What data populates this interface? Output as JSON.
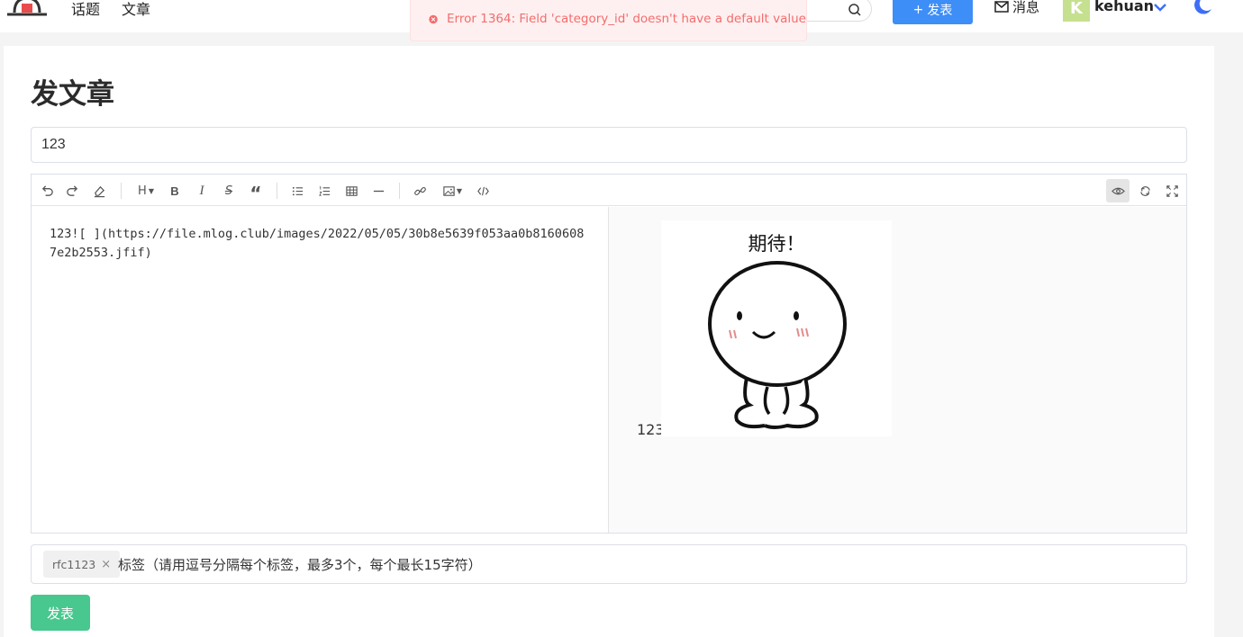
{
  "nav": {
    "links": [
      "话题",
      "文章"
    ],
    "publish_label": "发表",
    "messages_label": "消息",
    "avatar_letter": "K",
    "username": "kehuan"
  },
  "toast": {
    "type": "error",
    "message": "Error 1364: Field 'category_id' doesn't have a default value"
  },
  "page": {
    "title": "发文章",
    "title_input_value": "123"
  },
  "toolbar": {
    "items": [
      "undo",
      "redo",
      "clear-format",
      "heading",
      "bold",
      "italic",
      "strikethrough",
      "quote",
      "unordered-list",
      "ordered-list",
      "table",
      "horizontal-rule",
      "link",
      "image",
      "code-block",
      "preview",
      "sync-scroll",
      "fullscreen"
    ],
    "heading_label": "H",
    "bold_label": "B",
    "italic_label": "I",
    "strike_label": "S",
    "quote_label": "“"
  },
  "editor": {
    "content": "123![ ](https://file.mlog.club/images/2022/05/05/30b8e5639f053aa0b81606087e2b2553.jfif)",
    "preview_text": "123",
    "preview_image_caption": "期待！"
  },
  "tags": {
    "chips": [
      {
        "label": "rfc1123",
        "close": "×"
      }
    ],
    "placeholder": "标签（请用逗号分隔每个标签，最多3个，每个最长15字符）"
  },
  "publish_button_label": "发表",
  "colors": {
    "primary": "#3e8ef7",
    "success": "#48c78e",
    "error": "#f56c6c",
    "avatar": "#c5e08f"
  }
}
